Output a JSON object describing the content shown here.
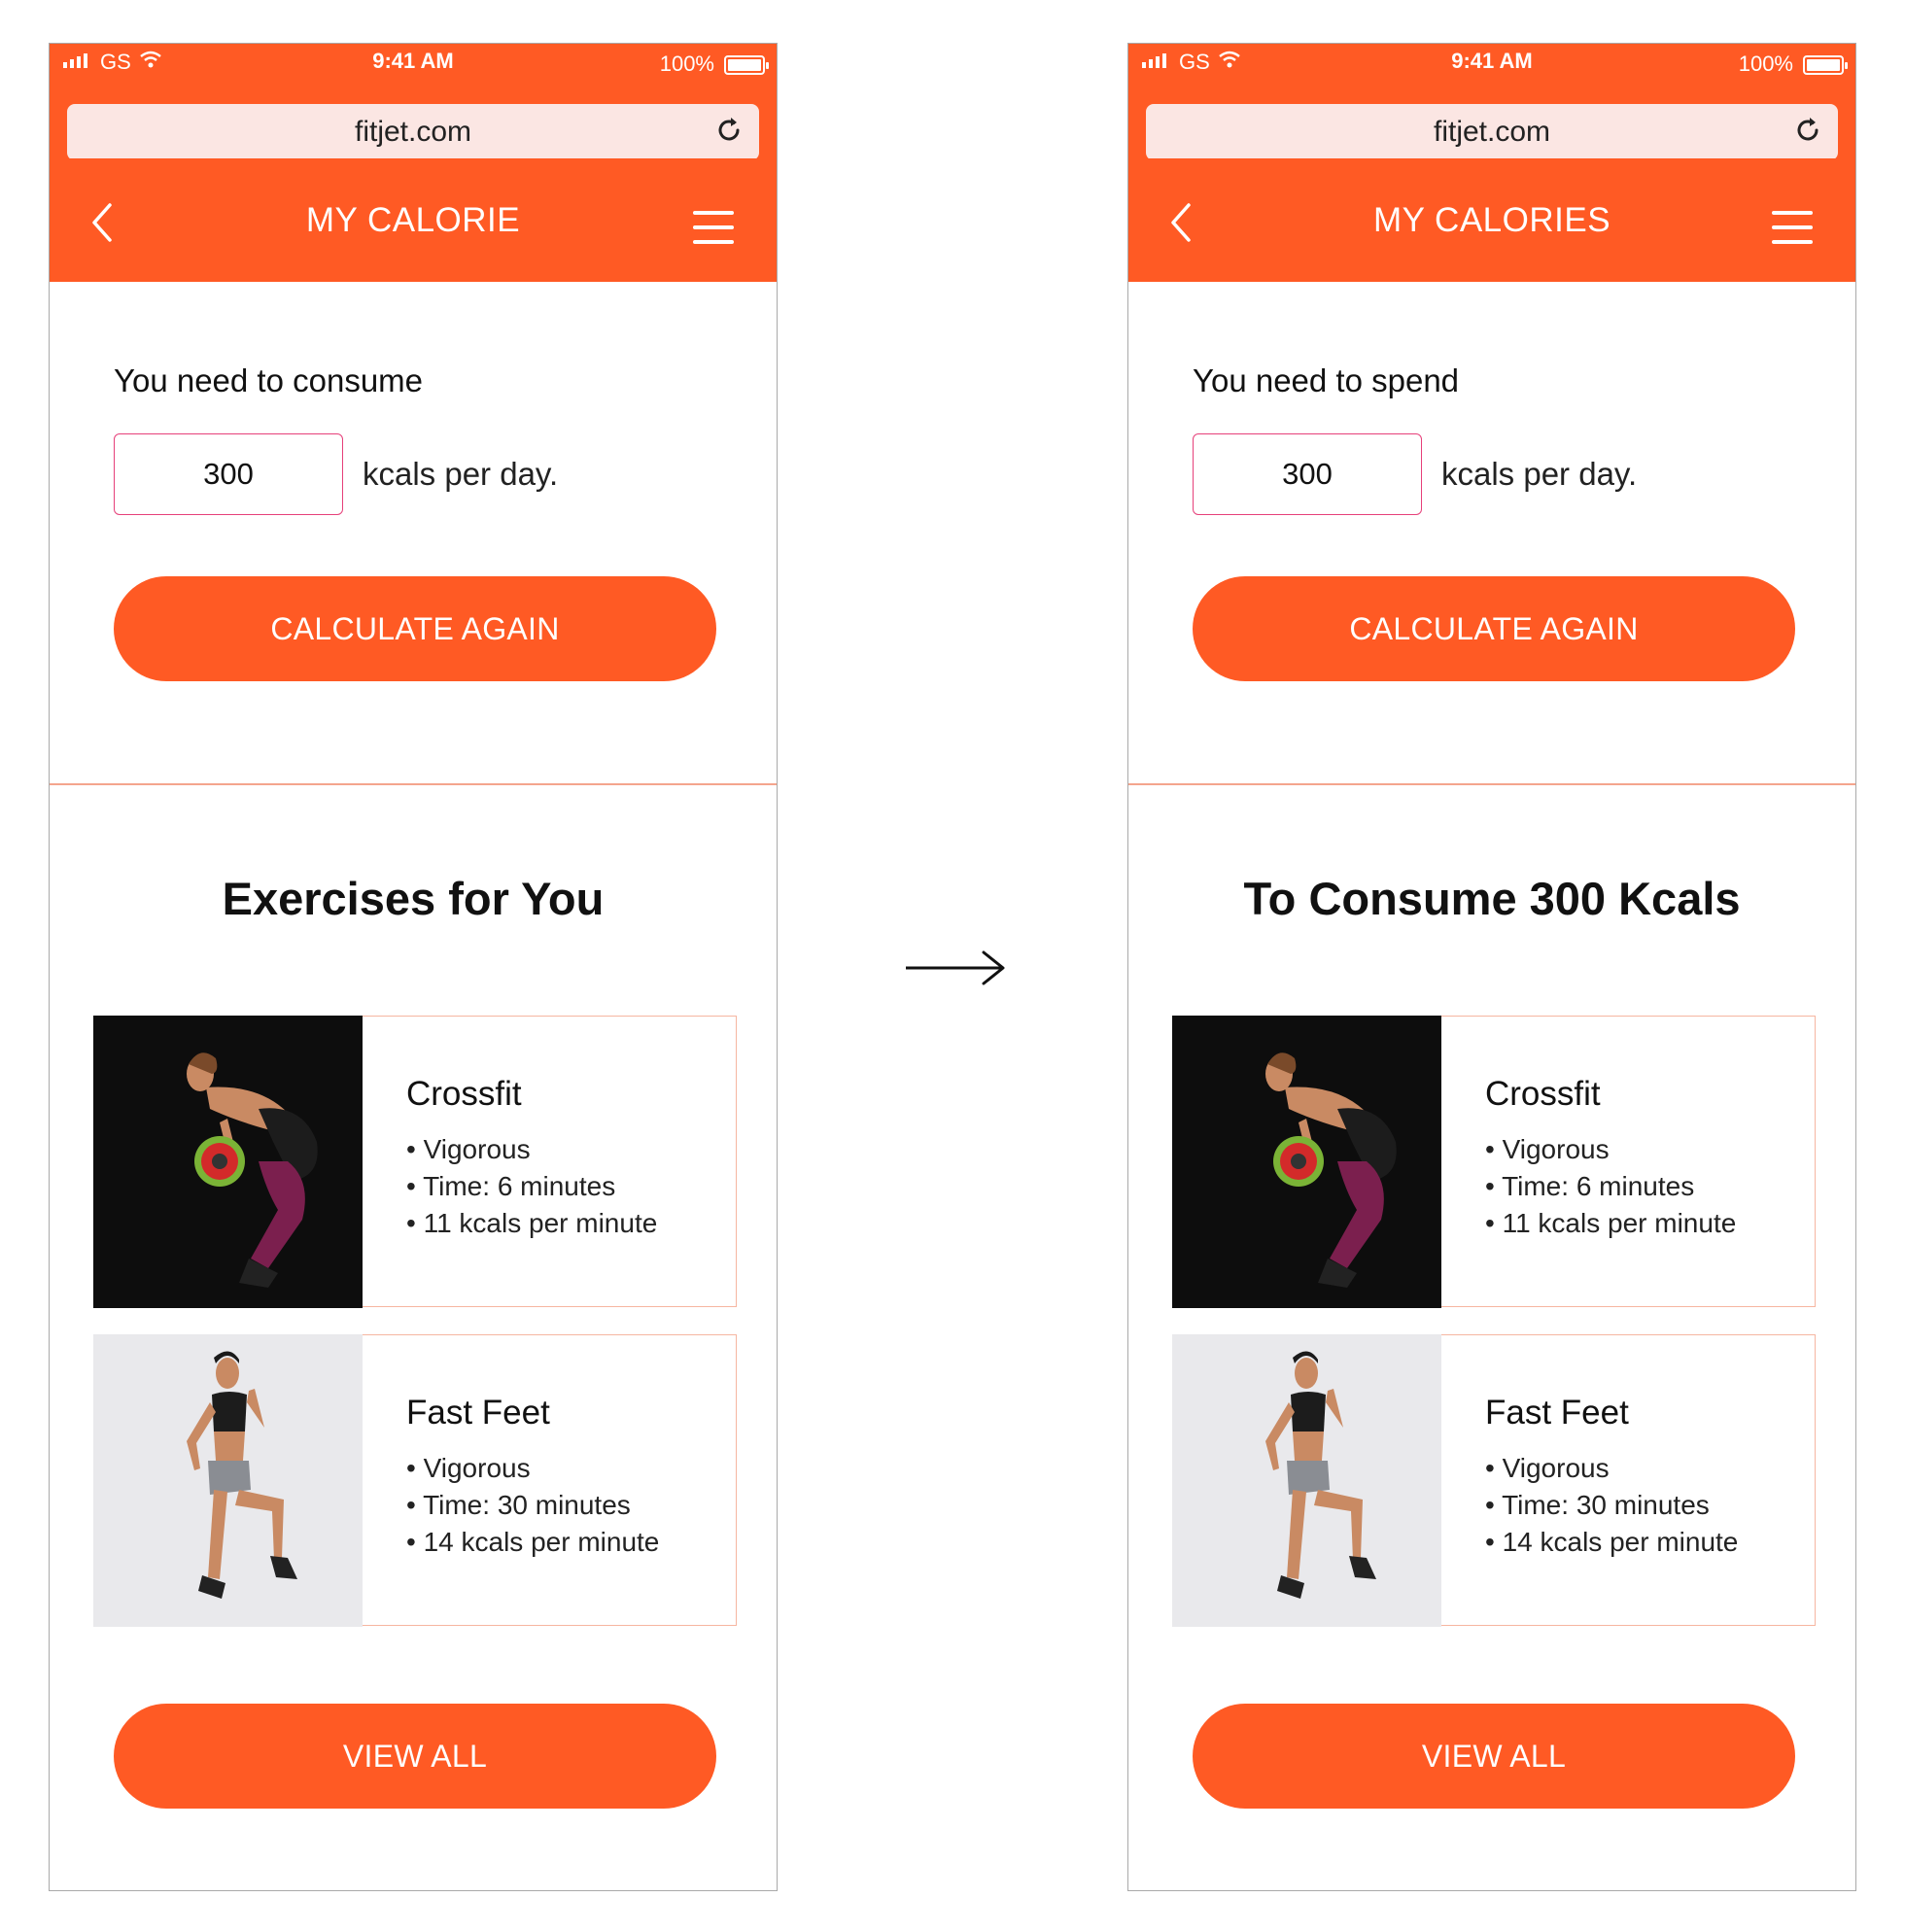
{
  "screens": [
    {
      "status": {
        "carrier": "GS",
        "time": "9:41 AM",
        "battery": "100%"
      },
      "url": "fitjet.com",
      "nav_title": "MY CALORIE",
      "need_label": "You need to consume",
      "kcal_value": "300",
      "per_day": "kcals per day.",
      "calc_button": "CALCULATE AGAIN",
      "section_title": "Exercises for You",
      "cards": [
        {
          "name": "Crossfit",
          "details": [
            "• Vigorous",
            "• Time: 6 minutes",
            "• 11 kcals per minute"
          ]
        },
        {
          "name": "Fast Feet",
          "details": [
            "• Vigorous",
            "• Time: 30 minutes",
            "• 14 kcals per minute"
          ]
        }
      ],
      "view_all_button": "VIEW ALL"
    },
    {
      "status": {
        "carrier": "GS",
        "time": "9:41 AM",
        "battery": "100%"
      },
      "url": "fitjet.com",
      "nav_title": "MY CALORIES",
      "need_label": "You need to spend",
      "kcal_value": "300",
      "per_day": "kcals per day.",
      "calc_button": "CALCULATE AGAIN",
      "section_title": "To Consume 300 Kcals",
      "cards": [
        {
          "name": "Crossfit",
          "details": [
            "• Vigorous",
            "• Time: 6 minutes",
            "• 11 kcals per minute"
          ]
        },
        {
          "name": "Fast Feet",
          "details": [
            "• Vigorous",
            "• Time: 30 minutes",
            "• 14 kcals per minute"
          ]
        }
      ],
      "view_all_button": "VIEW ALL"
    }
  ],
  "icons": {
    "signal": "signal-icon",
    "wifi": "wifi-icon",
    "battery": "battery-icon",
    "reload": "reload-icon",
    "back": "chevron-left-icon",
    "menu": "hamburger-menu-icon",
    "arrow": "right-arrow-icon"
  },
  "colors": {
    "brand": "#ff5a24",
    "url_bar": "#fbe6e3",
    "input_border": "#e6407a",
    "card_border": "#f6b6a1"
  }
}
